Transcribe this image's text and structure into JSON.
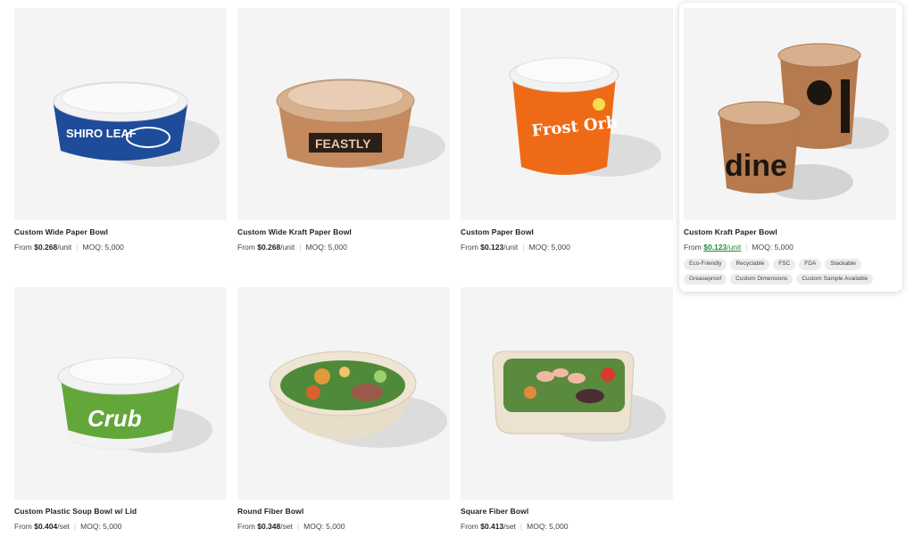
{
  "products": [
    {
      "title": "Custom Wide Paper Bowl",
      "from": "From",
      "price": "$0.268",
      "unit": "/unit",
      "moq": "MOQ: 5,000",
      "brand": "SHIRO LEAF"
    },
    {
      "title": "Custom Wide Kraft Paper Bowl",
      "from": "From",
      "price": "$0.268",
      "unit": "/unit",
      "moq": "MOQ: 5,000",
      "brand": "FEASTLY"
    },
    {
      "title": "Custom Paper Bowl",
      "from": "From",
      "price": "$0.123",
      "unit": "/unit",
      "moq": "MOQ: 5,000",
      "brand": "Frost Orb"
    },
    {
      "title": "Custom Kraft Paper Bowl",
      "from": "From",
      "price": "$0.123",
      "unit": "/unit",
      "moq": "MOQ: 5,000",
      "brand": "dine",
      "tags": [
        "Eco-Friendly",
        "Recyclable",
        "FSC",
        "FDA",
        "Stackable",
        "Greaseproof",
        "Custom Dimensions",
        "Custom Sample Available"
      ]
    },
    {
      "title": "Custom Plastic Soup Bowl w/ Lid",
      "from": "From",
      "price": "$0.404",
      "unit": "/set",
      "moq": "MOQ: 5,000",
      "brand": "Crub"
    },
    {
      "title": "Round Fiber Bowl",
      "from": "From",
      "price": "$0.348",
      "unit": "/set",
      "moq": "MOQ: 5,000"
    },
    {
      "title": "Square Fiber Bowl",
      "from": "From",
      "price": "$0.413",
      "unit": "/set",
      "moq": "MOQ: 5,000"
    }
  ],
  "colors": {
    "link_green": "#1f8a3a",
    "image_bg": "#f4f4f4",
    "tag_bg": "#ececec"
  }
}
